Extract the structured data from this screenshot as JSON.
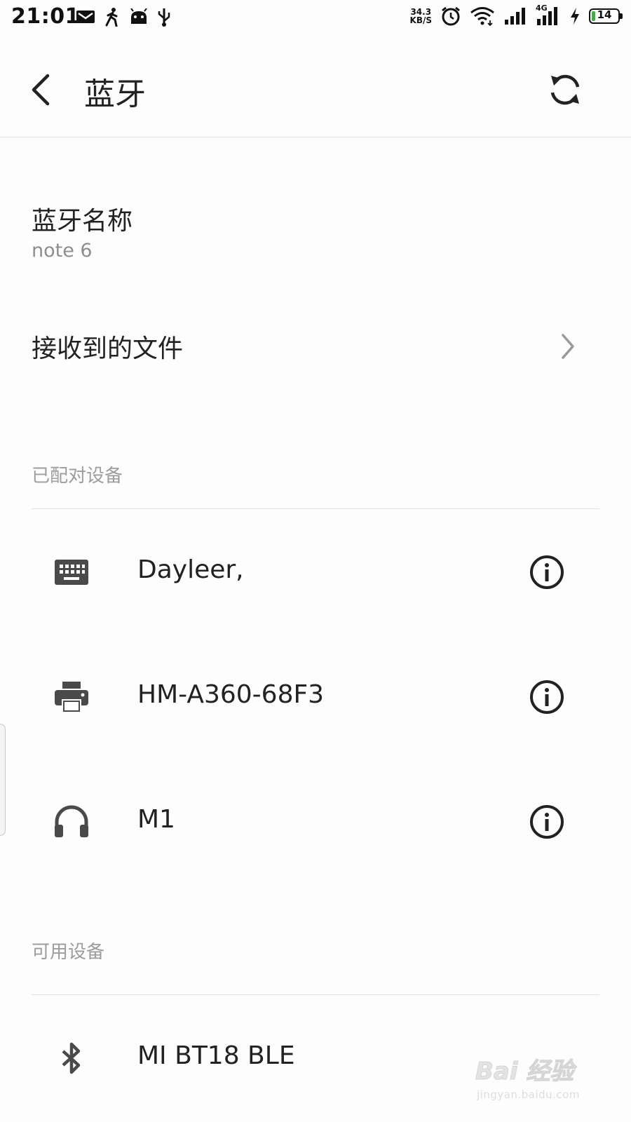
{
  "status_bar": {
    "time": "21:01",
    "network_speed_value": "34.3",
    "network_speed_unit": "KB/S",
    "network_type": "4G",
    "battery_level": "14",
    "battery_fraction": 0.14,
    "icons": [
      "mail-icon",
      "walking-icon",
      "android-icon",
      "usb-icon",
      "alarm-icon",
      "wifi-icon",
      "signal-icon",
      "signal-4g-icon",
      "charging-icon",
      "battery-icon"
    ]
  },
  "app_bar": {
    "title": "蓝牙",
    "back_icon": "back-arrow-icon",
    "refresh_icon": "refresh-icon"
  },
  "bluetooth_name": {
    "title": "蓝牙名称",
    "value": "note 6"
  },
  "received_files": {
    "label": "接收到的文件"
  },
  "paired_section": {
    "header": "已配对设备",
    "devices": [
      {
        "name": "Dayleer,",
        "icon": "keyboard-icon"
      },
      {
        "name": "HM-A360-68F3",
        "icon": "printer-icon"
      },
      {
        "name": "M1",
        "icon": "headphones-icon"
      }
    ]
  },
  "available_section": {
    "header": "可用设备",
    "devices": [
      {
        "name": "MI BT18 BLE",
        "icon": "bluetooth-icon"
      }
    ]
  },
  "watermark": {
    "brand": "Bai 经验",
    "url": "jingyan.baidu.com"
  },
  "colors": {
    "text_primary": "#222222",
    "text_secondary": "#8e8e8e",
    "section_header": "#9d9d9d",
    "icon": "#4a4a4a",
    "battery_fill": "#3cb043"
  }
}
